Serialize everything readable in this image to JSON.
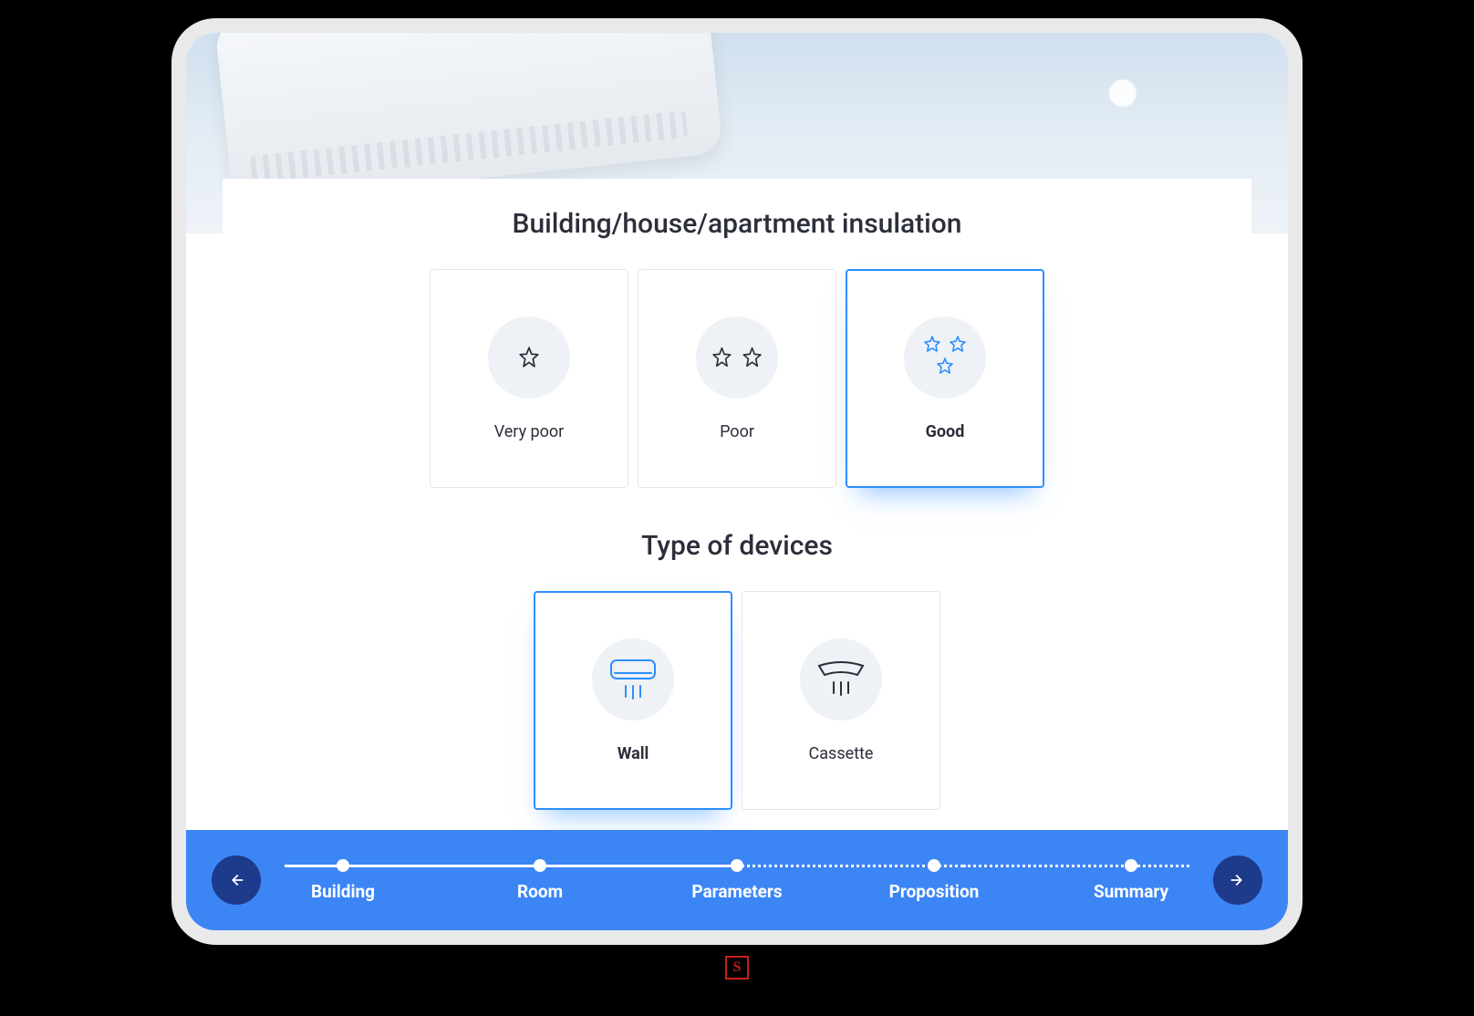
{
  "sections": {
    "insulation": {
      "title": "Building/house/apartment insulation",
      "options": [
        {
          "id": "very-poor",
          "label": "Very poor",
          "stars": 1,
          "selected": false
        },
        {
          "id": "poor",
          "label": "Poor",
          "stars": 2,
          "selected": false
        },
        {
          "id": "good",
          "label": "Good",
          "stars": 3,
          "selected": true
        }
      ]
    },
    "device_type": {
      "title": "Type of devices",
      "options": [
        {
          "id": "wall",
          "label": "Wall",
          "selected": true
        },
        {
          "id": "cassette",
          "label": "Cassette",
          "selected": false
        }
      ]
    }
  },
  "stepper": {
    "steps": [
      {
        "id": "building",
        "label": "Building",
        "state": "done"
      },
      {
        "id": "room",
        "label": "Room",
        "state": "done"
      },
      {
        "id": "parameters",
        "label": "Parameters",
        "state": "current"
      },
      {
        "id": "proposition",
        "label": "Proposition",
        "state": "todo"
      },
      {
        "id": "summary",
        "label": "Summary",
        "state": "todo"
      }
    ]
  },
  "brand_mark": "S",
  "colors": {
    "accent": "#2d8eff",
    "stepper_bg": "#3c85f5",
    "nav_button": "#1e3a8a",
    "text": "#2c2f3a"
  }
}
